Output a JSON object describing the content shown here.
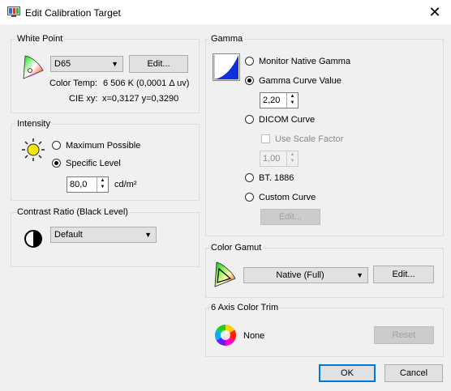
{
  "window": {
    "title": "Edit Calibration Target",
    "close_glyph": "✕"
  },
  "white_point": {
    "group_label": "White Point",
    "preset": "D65",
    "edit_label": "Edit...",
    "color_temp_label": "Color Temp:",
    "color_temp_value": "6 506 K (0,0001 Δ uv)",
    "cie_label": "CIE xy:",
    "cie_value": "x=0,3127 y=0,3290"
  },
  "intensity": {
    "group_label": "Intensity",
    "max_label": "Maximum Possible",
    "specific_label": "Specific Level",
    "value": "80,0",
    "unit": "cd/m²"
  },
  "contrast": {
    "group_label": "Contrast Ratio (Black Level)",
    "value": "Default"
  },
  "gamma": {
    "group_label": "Gamma",
    "native_label": "Monitor Native Gamma",
    "curve_value_label": "Gamma Curve Value",
    "curve_value": "2,20",
    "dicom_label": "DICOM Curve",
    "scale_factor_label": "Use Scale Factor",
    "scale_factor_value": "1,00",
    "bt1886_label": "BT. 1886",
    "custom_label": "Custom Curve",
    "edit_label": "Edit..."
  },
  "color_gamut": {
    "group_label": "Color Gamut",
    "value": "Native (Full)",
    "edit_label": "Edit..."
  },
  "axis_trim": {
    "group_label": "6 Axis Color Trim",
    "value": "None",
    "reset_label": "Reset"
  },
  "footer": {
    "ok_label": "OK",
    "cancel_label": "Cancel"
  }
}
